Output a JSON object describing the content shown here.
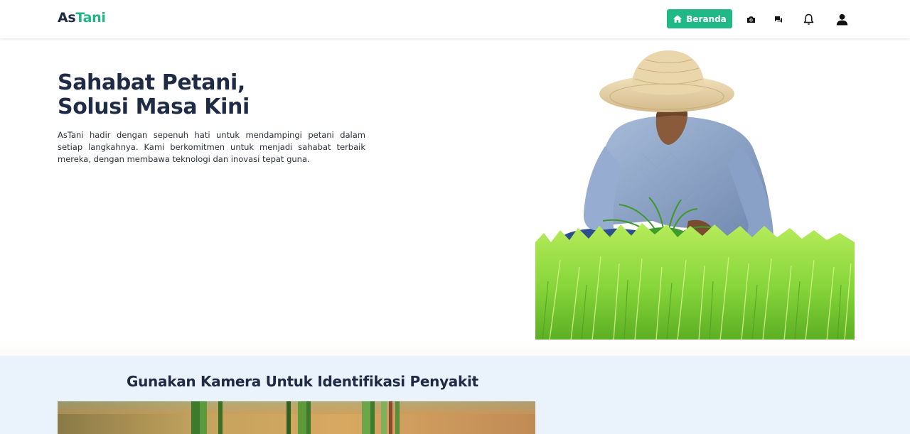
{
  "brand": {
    "name_part1": "As",
    "name_part2": "Tani"
  },
  "nav": {
    "home_label": "Beranda",
    "icons": [
      "camera-icon",
      "chat-icon",
      "bell-icon",
      "user-icon"
    ]
  },
  "hero": {
    "title_line1": "Sahabat Petani,",
    "title_line2": "Solusi Masa Kini",
    "description": "AsTani hadir dengan sepenuh hati untuk mendampingi petani dalam setiap langkahnya. Kami berkomitmen untuk menjadi sahabat terbaik mereka, dengan membawa teknologi dan inovasi tepat guna."
  },
  "camera_section": {
    "title": "Gunakan Kamera Untuk Identifikasi Penyakit"
  },
  "colors": {
    "accent": "#20b886",
    "heading": "#1f2a44",
    "section_bg": "#eaf2fb"
  }
}
